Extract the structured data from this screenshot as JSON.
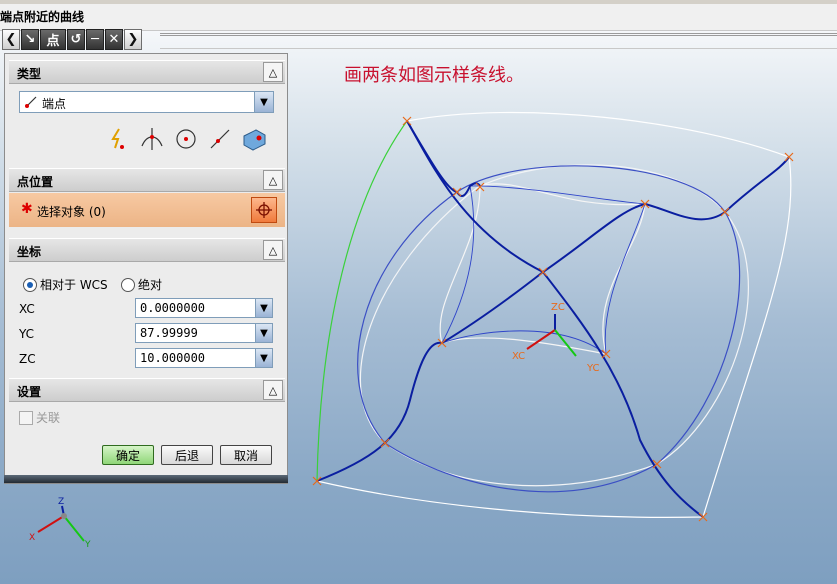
{
  "window": {
    "title": "端点附近的曲线"
  },
  "toolbar": {
    "point_label": "点"
  },
  "annotation": {
    "text": "画两条如图示样条线。"
  },
  "sections": {
    "type": {
      "title": "类型",
      "selected": "端点"
    },
    "point_location": {
      "title": "点位置",
      "select_label": "选择对象 (0)"
    },
    "coordinates": {
      "title": "坐标",
      "relative_wcs": "相对于 WCS",
      "absolute": "绝对",
      "xc_label": "XC",
      "xc_value": "0.0000000",
      "yc_label": "YC",
      "yc_value": "87.99999",
      "zc_label": "ZC",
      "zc_value": "10.000000"
    },
    "settings": {
      "title": "设置",
      "associative": "关联"
    }
  },
  "buttons": {
    "ok": "确定",
    "back": "后退",
    "cancel": "取消"
  },
  "viewport": {
    "csys_labels": {
      "xc": "XC",
      "yc": "YC",
      "zc": "ZC"
    },
    "triad_labels": {
      "x": "X",
      "y": "Y",
      "z": "Z"
    }
  },
  "colors": {
    "accent": "#ecb486",
    "curve_blue": "#0a1ea0",
    "curve_green": "#3ad13a",
    "annotation": "#c8102e"
  }
}
